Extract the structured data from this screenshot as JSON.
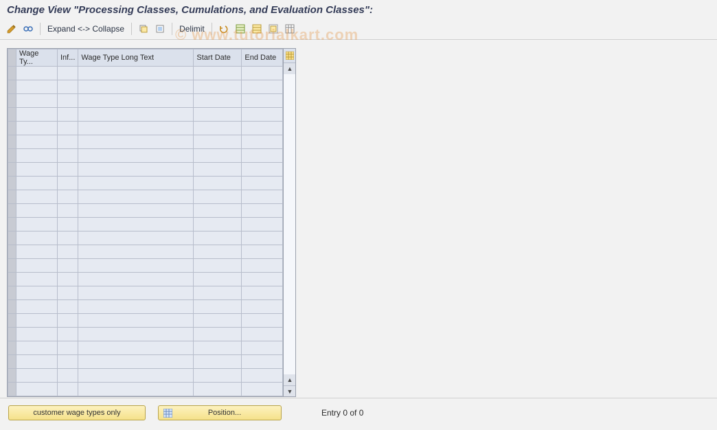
{
  "title": "Change View \"Processing Classes, Cumulations, and Evaluation Classes\":",
  "toolbar": {
    "expand_collapse": "Expand <-> Collapse",
    "delimit": "Delimit"
  },
  "table": {
    "columns": {
      "wage_type": "Wage Ty...",
      "inf": "Inf...",
      "long_text": "Wage Type Long Text",
      "start_date": "Start Date",
      "end_date": "End Date"
    },
    "row_count": 24
  },
  "buttons": {
    "customer_wage": "customer wage types only",
    "position": "Position..."
  },
  "footer": {
    "entry_text": "Entry 0 of 0"
  },
  "watermark": "© www.tutorialkart.com",
  "icons": {
    "pencil_glasses": "✎",
    "glasses": "👓",
    "copy": "⧉",
    "page": "▥",
    "undo": "↶",
    "save": "💾",
    "select_all": "▦",
    "select_block": "▤",
    "deselect": "▯",
    "config": "▦",
    "grid": "▦"
  }
}
